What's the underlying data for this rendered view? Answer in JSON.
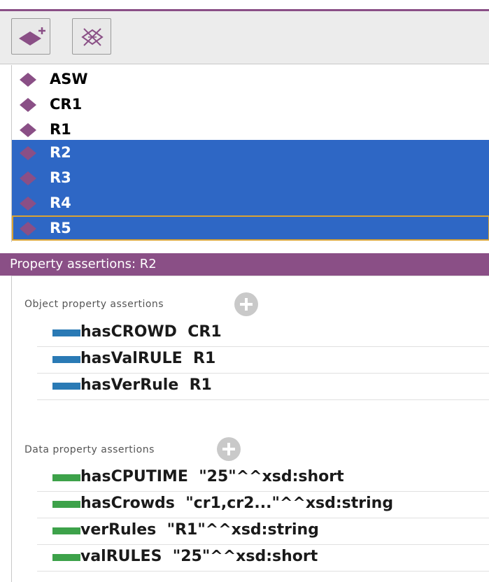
{
  "toolbar": {
    "add_icon": "add-individual-icon",
    "delete_icon": "delete-individual-icon"
  },
  "individuals": {
    "items": [
      {
        "label": "ASW",
        "selected": false
      },
      {
        "label": "CR1",
        "selected": false
      },
      {
        "label": "R1",
        "selected": false
      },
      {
        "label": "R2",
        "selected": true
      },
      {
        "label": "R3",
        "selected": true
      },
      {
        "label": "R4",
        "selected": true
      },
      {
        "label": "R5",
        "selected": true
      }
    ],
    "selection_color": "#2e67c5",
    "diamond_color": "#8a4f86"
  },
  "property_panel": {
    "title": "Property assertions: R2",
    "header_color": "#8a4f86",
    "object_section": {
      "title": "Object property assertions",
      "bar_color": "#2a7ab5",
      "rows": [
        {
          "property": "hasCROWD",
          "value": "CR1"
        },
        {
          "property": "hasValRULE",
          "value": "R1"
        },
        {
          "property": "hasVerRule",
          "value": "R1"
        }
      ]
    },
    "data_section": {
      "title": "Data property assertions",
      "bar_color": "#3da24a",
      "rows": [
        {
          "property": "hasCPUTIME",
          "value": "\"25\"^^xsd:short"
        },
        {
          "property": "hasCrowds",
          "value": "\"cr1,cr2...\"^^xsd:string"
        },
        {
          "property": "verRules",
          "value": "\"R1\"^^xsd:string"
        },
        {
          "property": "valRULES",
          "value": "\"25\"^^xsd:short"
        }
      ]
    }
  }
}
